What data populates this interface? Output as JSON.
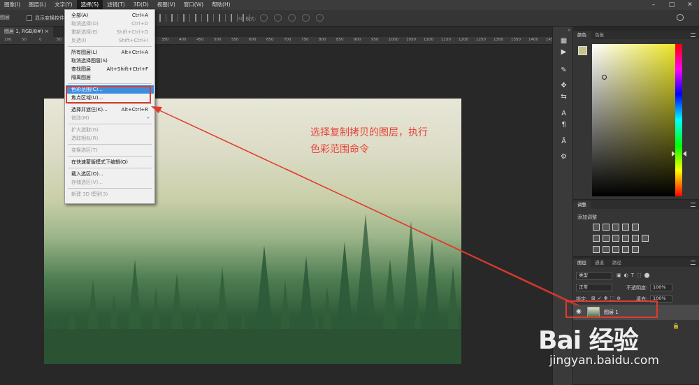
{
  "menubar": {
    "items": [
      "图像(I)",
      "图层(L)",
      "文字(Y)",
      "选择(S)",
      "滤镜(T)",
      "3D(D)",
      "视图(V)",
      "窗口(W)",
      "帮助(H)"
    ],
    "active_index": 3,
    "window_controls": [
      "–",
      "□",
      "✕"
    ]
  },
  "optbar": {
    "left_label": "图层",
    "transform_label": "显示变换控件",
    "mode3d_label": "3D 模式:"
  },
  "doctab": {
    "label": "图层 1, RGB/8#) ×"
  },
  "ruler": {
    "ticks": [
      "100",
      "50",
      "0",
      "50",
      "100",
      "150",
      "200",
      "250",
      "300",
      "350",
      "400",
      "450",
      "500",
      "550",
      "600",
      "650",
      "700",
      "750",
      "800",
      "850",
      "900",
      "950",
      "1000",
      "1050",
      "1100",
      "1150",
      "1200",
      "1250",
      "1300",
      "1350",
      "1400",
      "1450",
      "1500"
    ]
  },
  "dropdown": {
    "items": [
      {
        "label": "全部(A)",
        "shortcut": "Ctrl+A",
        "disabled": false
      },
      {
        "label": "取消选择(D)",
        "shortcut": "Ctrl+D",
        "disabled": true
      },
      {
        "label": "重新选择(E)",
        "shortcut": "Shift+Ctrl+D",
        "disabled": true
      },
      {
        "label": "反选(I)",
        "shortcut": "Shift+Ctrl+I",
        "disabled": true
      },
      {
        "label": "所有图层(L)",
        "shortcut": "Alt+Ctrl+A",
        "disabled": false
      },
      {
        "label": "取消选择图层(S)",
        "shortcut": "",
        "disabled": false
      },
      {
        "label": "查找图层",
        "shortcut": "Alt+Shift+Ctrl+F",
        "disabled": false
      },
      {
        "label": "隔离图层",
        "shortcut": "",
        "disabled": false
      },
      {
        "label": "色彩范围(C)...",
        "shortcut": "",
        "disabled": false,
        "highlight": true
      },
      {
        "label": "焦点区域(U)...",
        "shortcut": "",
        "disabled": false
      },
      {
        "label": "选择并遮住(K)...",
        "shortcut": "Alt+Ctrl+R",
        "disabled": false
      },
      {
        "label": "修改(M)",
        "shortcut": "",
        "disabled": true,
        "submenu": true
      },
      {
        "label": "扩大选取(G)",
        "shortcut": "",
        "disabled": true
      },
      {
        "label": "选取相似(R)",
        "shortcut": "",
        "disabled": true
      },
      {
        "label": "变换选区(T)",
        "shortcut": "",
        "disabled": true
      },
      {
        "label": "在快速蒙版模式下编辑(Q)",
        "shortcut": "",
        "disabled": false
      },
      {
        "label": "载入选区(O)...",
        "shortcut": "",
        "disabled": false
      },
      {
        "label": "存储选区(V)...",
        "shortcut": "",
        "disabled": true
      },
      {
        "label": "新建 3D 模型(3)",
        "shortcut": "",
        "disabled": true
      }
    ]
  },
  "callout": {
    "line1": "选择复制拷贝的图层，执行",
    "line2": "色彩范围命令",
    "color": "#e8433b"
  },
  "color_panel": {
    "tabs": [
      "颜色",
      "色板"
    ],
    "foreground": "#c8c38a",
    "background": "#ffffff"
  },
  "adjust_panel": {
    "tab": "调整",
    "title": "添加调整"
  },
  "layers_panel": {
    "tabs": [
      "图层",
      "通道",
      "路径"
    ],
    "filter_kind": "类型",
    "blend_mode": "正常",
    "opacity_label": "不透明度:",
    "opacity_value": "100%",
    "lock_label": "锁定:",
    "fill_label": "填充:",
    "fill_value": "100%",
    "layer_name": "图层 1"
  },
  "watermark": {
    "logo": "Bai 经验",
    "url": "jingyan.baidu.com"
  }
}
